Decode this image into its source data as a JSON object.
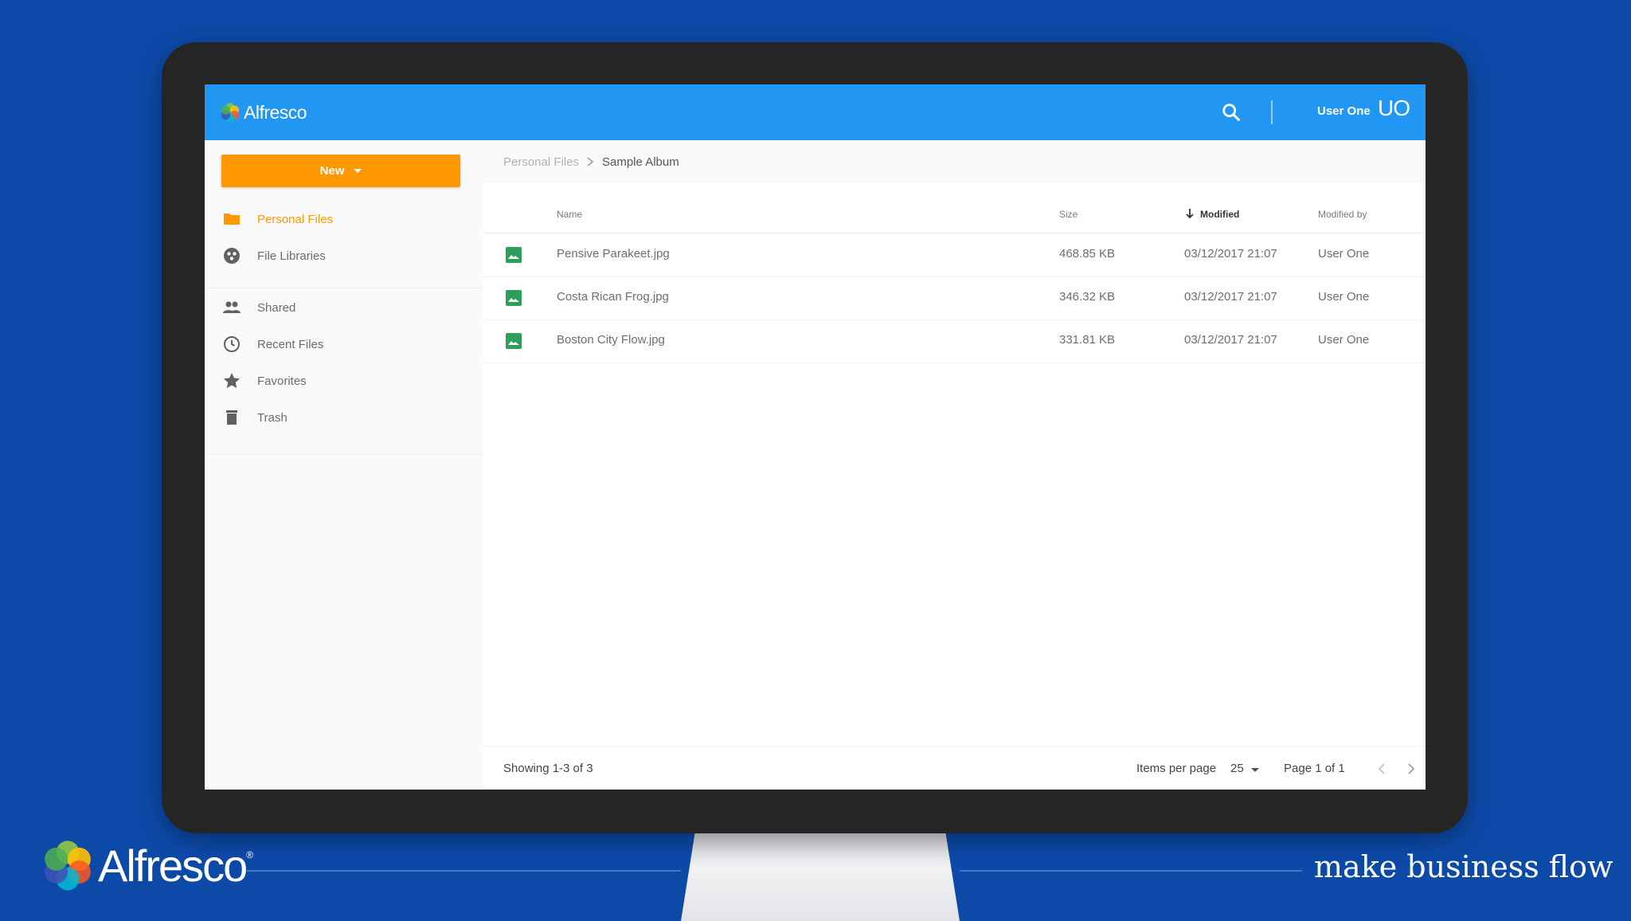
{
  "app": {
    "logo_text": "Alfresco",
    "user_name": "User One",
    "user_initials": "UO"
  },
  "sidebar": {
    "new_label": "New",
    "items": [
      {
        "label": "Personal Files",
        "icon": "folder-icon",
        "active": true
      },
      {
        "label": "File Libraries",
        "icon": "libraries-icon",
        "active": false
      },
      {
        "label": "Shared",
        "icon": "people-icon",
        "active": false
      },
      {
        "label": "Recent Files",
        "icon": "clock-icon",
        "active": false
      },
      {
        "label": "Favorites",
        "icon": "star-icon",
        "active": false
      },
      {
        "label": "Trash",
        "icon": "trash-icon",
        "active": false
      }
    ]
  },
  "breadcrumb": {
    "parent": "Personal Files",
    "current": "Sample Album"
  },
  "table": {
    "columns": {
      "name": "Name",
      "size": "Size",
      "modified": "Modified",
      "modified_by": "Modified by"
    },
    "sorted_by": "Modified",
    "rows": [
      {
        "name": "Pensive Parakeet.jpg",
        "size": "468.85 KB",
        "modified": "03/12/2017 21:07",
        "modified_by": "User One"
      },
      {
        "name": "Costa Rican Frog.jpg",
        "size": "346.32 KB",
        "modified": "03/12/2017 21:07",
        "modified_by": "User One"
      },
      {
        "name": "Boston City Flow.jpg",
        "size": "331.81 KB",
        "modified": "03/12/2017 21:07",
        "modified_by": "User One"
      }
    ]
  },
  "pagination": {
    "showing": "Showing 1-3 of 3",
    "items_per_page_label": "Items per page",
    "items_per_page_value": "25",
    "page_info": "Page 1 of 1"
  },
  "banner": {
    "logo_text": "Alfresco",
    "registered_mark": "®",
    "tagline": "make business flow"
  },
  "colors": {
    "background": "#0d4aa8",
    "header": "#2196f3",
    "accent": "#ff9800",
    "file_icon": "#2e9e5b"
  }
}
